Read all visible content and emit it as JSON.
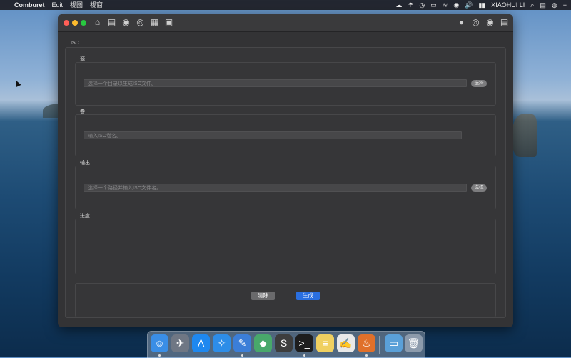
{
  "menubar": {
    "apple_glyph": "",
    "app_name": "Comburet",
    "menus": [
      "Edit",
      "视图",
      "视窗"
    ],
    "status_glyphs": [
      "☁",
      "☂",
      "◷",
      "▭",
      "≋",
      "◉",
      "🔊",
      "▮▮"
    ],
    "user_name": "XIAOHUI LI",
    "search_glyph": "⌕",
    "flag_glyph": "▤",
    "siri_glyph": "◍",
    "list_glyph": "≡"
  },
  "window": {
    "toolbar_left_glyphs": [
      "⌂",
      "▤",
      "◉",
      "◎",
      "▦",
      "▣"
    ],
    "toolbar_right_glyphs": [
      "●",
      "◎",
      "◉",
      "▤"
    ],
    "panel_title": "ISO",
    "source": {
      "title": "源",
      "placeholder": "选择一个目录以生成ISO文件。",
      "button": "选择"
    },
    "volume": {
      "title": "卷",
      "placeholder": "输入ISO卷名。"
    },
    "output": {
      "title": "输出",
      "placeholder": "选择一个路径并输入ISO文件名。",
      "button": "选择"
    },
    "progress": {
      "title": "进度"
    },
    "actions": {
      "clear": "清除",
      "generate": "生成"
    }
  },
  "dock": {
    "apps": [
      {
        "name": "finder",
        "glyph": "☺",
        "color": "#3a8ee6",
        "running": true
      },
      {
        "name": "launchpad",
        "glyph": "✈",
        "color": "#6f7784",
        "running": false
      },
      {
        "name": "app-store",
        "glyph": "A",
        "color": "#1e88f0",
        "running": false
      },
      {
        "name": "safari",
        "glyph": "✧",
        "color": "#2d8de8",
        "running": false
      },
      {
        "name": "xcode",
        "glyph": "✎",
        "color": "#3b7ed8",
        "running": true
      },
      {
        "name": "vue-app",
        "glyph": "◆",
        "color": "#48a86b",
        "running": false
      },
      {
        "name": "sublime",
        "glyph": "S",
        "color": "#3d3d3d",
        "running": false
      },
      {
        "name": "terminal",
        "glyph": ">_",
        "color": "#1d1d1d",
        "running": true
      },
      {
        "name": "notes",
        "glyph": "≡",
        "color": "#f0d060",
        "running": false
      },
      {
        "name": "textedit",
        "glyph": "✍",
        "color": "#e8e8e8",
        "running": false
      },
      {
        "name": "comburet",
        "glyph": "♨",
        "color": "#e0702a",
        "running": true
      }
    ],
    "folder_glyph": "▭",
    "trash_glyph": "🗑"
  }
}
